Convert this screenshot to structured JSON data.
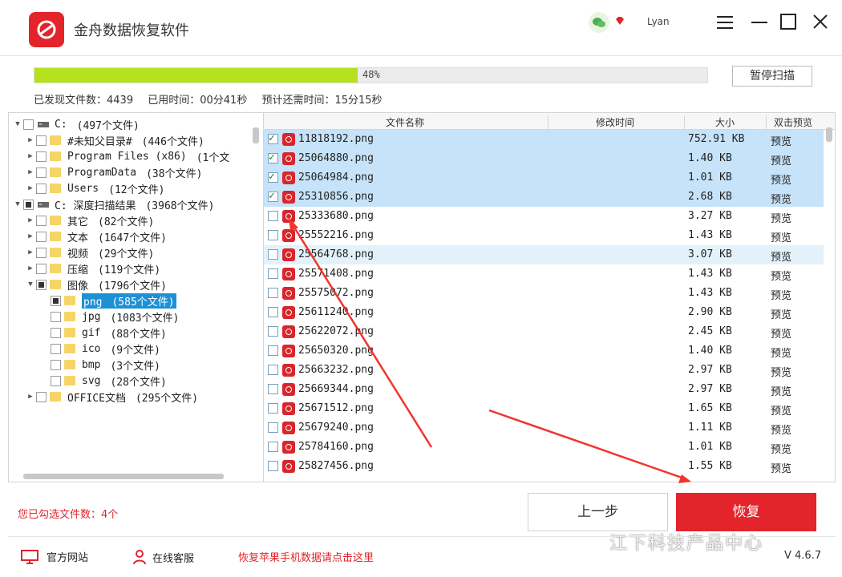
{
  "window": {
    "title": "金舟数据恢复软件",
    "username": "Lyan"
  },
  "scan": {
    "progress_label": "48%",
    "progress_value": 0.48,
    "pause_label": "暂停扫描",
    "found_label": "已发现文件数：4439",
    "elapsed_label": "已用时间：00分41秒",
    "remaining_label": "预计还需时间：15分15秒"
  },
  "tree": {
    "nodes": [
      {
        "label": "C:",
        "count": "(497个文件)"
      },
      {
        "label": "#未知父目录#",
        "count": "(446个文件)"
      },
      {
        "label": "Program Files (x86)",
        "count": "(1个文"
      },
      {
        "label": "ProgramData",
        "count": "(38个文件)"
      },
      {
        "label": "Users",
        "count": "(12个文件)"
      },
      {
        "label": "C: 深度扫描结果",
        "count": "(3968个文件)"
      },
      {
        "label": "其它",
        "count": "(82个文件)"
      },
      {
        "label": "文本",
        "count": "(1647个文件)"
      },
      {
        "label": "视频",
        "count": "(29个文件)"
      },
      {
        "label": "压缩",
        "count": "(119个文件)"
      },
      {
        "label": "图像",
        "count": "(1796个文件)"
      },
      {
        "label": "png",
        "count": "(585个文件)"
      },
      {
        "label": "jpg",
        "count": "(1083个文件)"
      },
      {
        "label": "gif",
        "count": "(88个文件)"
      },
      {
        "label": "ico",
        "count": "(9个文件)"
      },
      {
        "label": "bmp",
        "count": "(3个文件)"
      },
      {
        "label": "svg",
        "count": "(28个文件)"
      },
      {
        "label": "OFFICE文档",
        "count": "(295个文件)"
      }
    ]
  },
  "list": {
    "headers": {
      "name": "文件名称",
      "modified": "修改时间",
      "size": "大小",
      "preview": "双击预览"
    },
    "rows": [
      {
        "name": "11818192.png",
        "size": "752.91 KB",
        "preview": "预览",
        "checked": true
      },
      {
        "name": "25064880.png",
        "size": "1.40 KB",
        "preview": "预览",
        "checked": true
      },
      {
        "name": "25064984.png",
        "size": "1.01 KB",
        "preview": "预览",
        "checked": true
      },
      {
        "name": "25310856.png",
        "size": "2.68 KB",
        "preview": "预览",
        "checked": true
      },
      {
        "name": "25333680.png",
        "size": "3.27 KB",
        "preview": "预览",
        "checked": false
      },
      {
        "name": "25552216.png",
        "size": "1.43 KB",
        "preview": "预览",
        "checked": false
      },
      {
        "name": "25564768.png",
        "size": "3.07 KB",
        "preview": "预览",
        "checked": false
      },
      {
        "name": "25571408.png",
        "size": "1.43 KB",
        "preview": "预览",
        "checked": false
      },
      {
        "name": "25575072.png",
        "size": "1.43 KB",
        "preview": "预览",
        "checked": false
      },
      {
        "name": "25611240.png",
        "size": "2.90 KB",
        "preview": "预览",
        "checked": false
      },
      {
        "name": "25622072.png",
        "size": "2.45 KB",
        "preview": "预览",
        "checked": false
      },
      {
        "name": "25650320.png",
        "size": "1.40 KB",
        "preview": "预览",
        "checked": false
      },
      {
        "name": "25663232.png",
        "size": "2.97 KB",
        "preview": "预览",
        "checked": false
      },
      {
        "name": "25669344.png",
        "size": "2.97 KB",
        "preview": "预览",
        "checked": false
      },
      {
        "name": "25671512.png",
        "size": "1.65 KB",
        "preview": "预览",
        "checked": false
      },
      {
        "name": "25679240.png",
        "size": "1.11 KB",
        "preview": "预览",
        "checked": false
      },
      {
        "name": "25784160.png",
        "size": "1.01 KB",
        "preview": "预览",
        "checked": false
      },
      {
        "name": "25827456.png",
        "size": "1.55 KB",
        "preview": "预览",
        "checked": false
      }
    ]
  },
  "footer": {
    "selected_count": "您已勾选文件数：4个",
    "prev_label": "上一步",
    "recover_label": "恢复",
    "website_label": "官方网站",
    "support_label": "在线客服",
    "ios_label": "恢复苹果手机数据请点击这里",
    "version": "V 4.6.7",
    "watermark": "江下科技产品中心"
  },
  "colors": {
    "brand_red": "#e3242b",
    "progress_green": "#b5e11e",
    "selection_blue": "#c6e3f9",
    "tree_selection": "#1e90d6",
    "annotation_arrow": "#f0352b"
  }
}
